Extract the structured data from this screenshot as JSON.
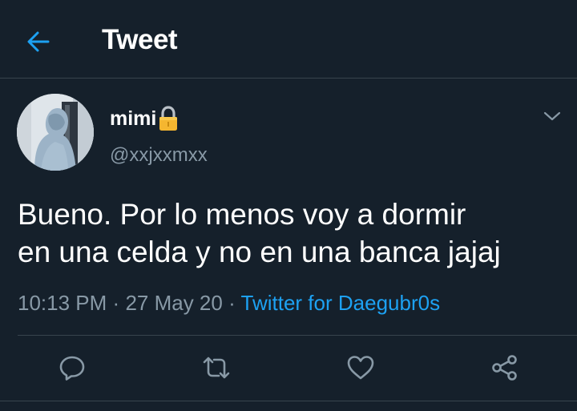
{
  "header": {
    "title": "Tweet",
    "back_icon": "arrow-left-icon"
  },
  "tweet": {
    "display_name": "mimi",
    "lock_icon": "lock-icon",
    "handle": "@xxjxxmxx",
    "text": "Bueno. Por lo menos voy a dormir\nen una celda y no en una banca jajaj",
    "time": "10:13 PM",
    "separator": "·",
    "date": "27 May 20",
    "source": "Twitter for Daegubr0s"
  },
  "actions": [
    {
      "name": "reply",
      "icon": "reply-icon"
    },
    {
      "name": "retweet",
      "icon": "retweet-icon"
    },
    {
      "name": "like",
      "icon": "heart-icon"
    },
    {
      "name": "share",
      "icon": "share-icon"
    }
  ],
  "colors": {
    "background": "#15202b",
    "accent": "#1da1f2",
    "secondary_text": "#8899a6",
    "divider": "#38444d"
  }
}
